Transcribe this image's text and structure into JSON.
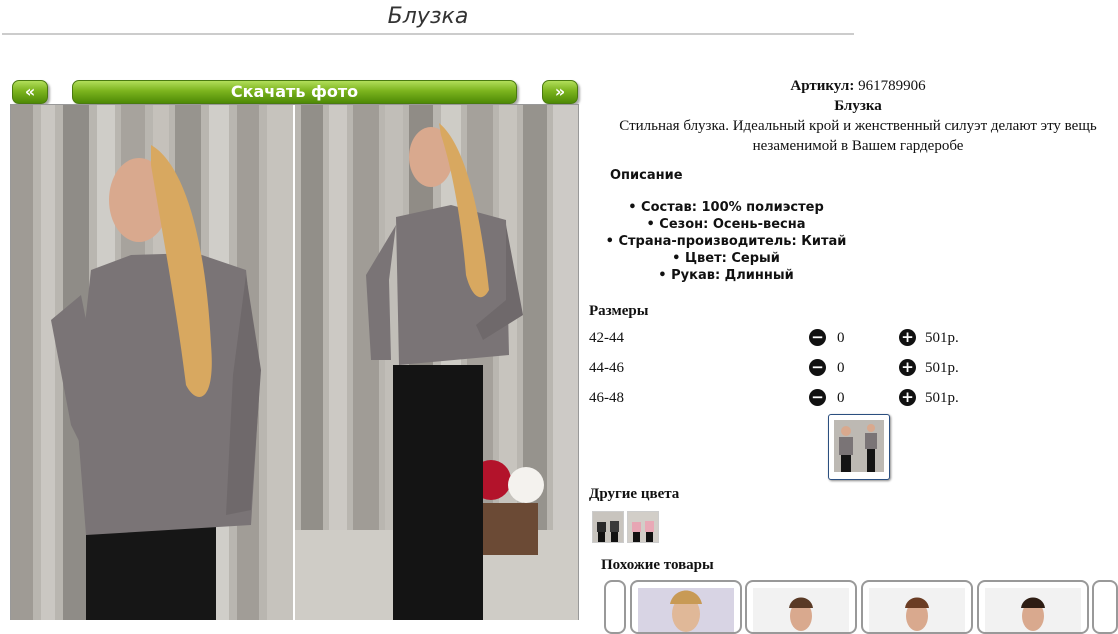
{
  "page": {
    "title": "Блузка"
  },
  "gallery": {
    "prev_label": "«",
    "next_label": "»",
    "download_label": "Скачать фото"
  },
  "product": {
    "article_label": "Артикул:",
    "article_value": "961789906",
    "name": "Блузка",
    "description_line1": "Стильная блузка. Идеальный крой и женственный силуэт делают эту вещь",
    "description_line2": "незаменимой в Вашем гардеробе",
    "details_heading": "Описание",
    "properties": [
      "Состав: 100% полиэстер",
      "Сезон: Осень-весна",
      "Страна-производитель: Китай",
      "Цвет: Серый",
      "Рукав: Длинный"
    ]
  },
  "sizes": {
    "heading": "Размеры",
    "rows": [
      {
        "size": "42-44",
        "qty": "0",
        "price": "501р."
      },
      {
        "size": "44-46",
        "qty": "0",
        "price": "501р."
      },
      {
        "size": "46-48",
        "qty": "0",
        "price": "501р."
      }
    ]
  },
  "other_colors": {
    "heading": "Другие цвета"
  },
  "similar": {
    "heading": "Похожие товары"
  },
  "icons": {
    "minus": "minus-circle-icon",
    "plus": "plus-circle-icon"
  },
  "colors": {
    "button_top": "#b2de5a",
    "button_bottom": "#4e8a06",
    "blouse": "#7a7476"
  }
}
